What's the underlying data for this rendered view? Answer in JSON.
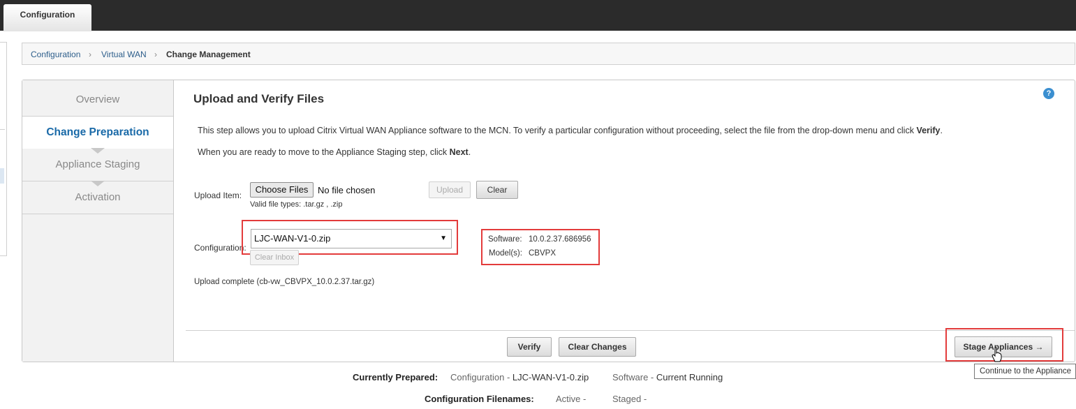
{
  "top_tab": {
    "label": "Configuration"
  },
  "breadcrumb": [
    {
      "label": "Configuration"
    },
    {
      "label": "Virtual WAN"
    },
    {
      "label": "Change Management"
    }
  ],
  "steps": [
    {
      "label": "Overview"
    },
    {
      "label": "Change Preparation"
    },
    {
      "label": "Appliance Staging"
    },
    {
      "label": "Activation"
    }
  ],
  "section": {
    "title": "Upload and Verify Files",
    "desc1_prefix": "This step allows you to upload Citrix Virtual WAN Appliance software to the MCN. To verify a particular configuration without proceeding, select the file from the drop-down menu and click ",
    "desc1_bold": "Verify",
    "desc1_suffix": ".",
    "desc2_prefix": "When you are ready to move to the Appliance Staging step, click ",
    "desc2_bold": "Next",
    "desc2_suffix": "."
  },
  "upload": {
    "label": "Upload Item:",
    "choose_files": "Choose Files",
    "no_file": "No file chosen",
    "upload_button": "Upload",
    "clear_button": "Clear",
    "valid_types": "Valid file types: .tar.gz , .zip"
  },
  "configuration": {
    "label": "Configuration:",
    "selected": "LJC-WAN-V1-0.zip",
    "clear_inbox": "Clear Inbox"
  },
  "info": {
    "software_label": "Software:",
    "software_value": "10.0.2.37.686956",
    "models_label": "Model(s):",
    "models_value": "CBVPX"
  },
  "upload_complete": "Upload complete (cb-vw_CBVPX_10.0.2.37.tar.gz)",
  "footer": {
    "verify": "Verify",
    "clear_changes": "Clear Changes",
    "stage_appliances": "Stage Appliances →"
  },
  "tooltip": "Continue to the Appliance",
  "summary": {
    "currently_prepared_label": "Currently Prepared:",
    "config_text": "Configuration - ",
    "config_value": "LJC-WAN-V1-0.zip",
    "software_text": "Software - ",
    "software_value": "Current Running",
    "filenames_label": "Configuration Filenames:",
    "active": "Active -",
    "staged": "Staged -"
  },
  "colors": {
    "accent": "#1a6aa8",
    "highlight_red": "#e33b3b",
    "topbar": "#2b2b2b"
  }
}
